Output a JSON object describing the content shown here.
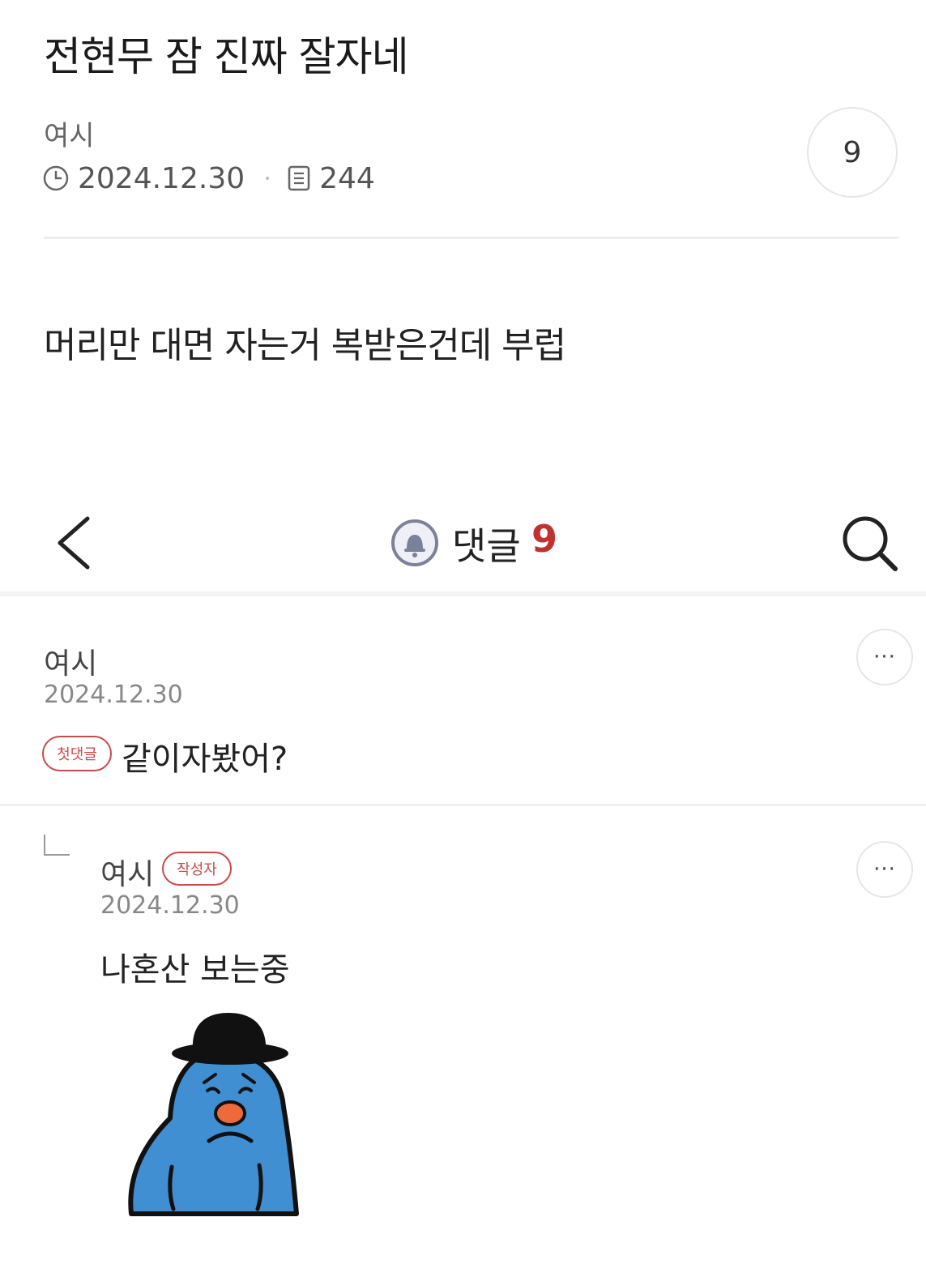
{
  "post": {
    "title": "전현무 잠 진짜 잘자네",
    "author": "여시",
    "date": "2024.12.30",
    "views": "244",
    "comment_count": "9",
    "body": "머리만 대면 자는거 복받은건데 부럽"
  },
  "comments_bar": {
    "label": "댓글",
    "count": "9",
    "icons": [
      "back-chevron-icon",
      "bell-icon",
      "search-icon"
    ]
  },
  "comments": [
    {
      "author": "여시",
      "date": "2024.12.30",
      "badge": "첫댓글",
      "text": "같이자봤어?",
      "more": "···"
    },
    {
      "author": "여시",
      "badge": "작성자",
      "date": "2024.12.30",
      "text": "나혼산 보는중",
      "more": "···",
      "sticker": "blue-character-sticker"
    }
  ],
  "colors": {
    "accent_red": "#c0312f",
    "badge_red": "#c94a4a",
    "sticker_blue": "#3f8fd2"
  }
}
